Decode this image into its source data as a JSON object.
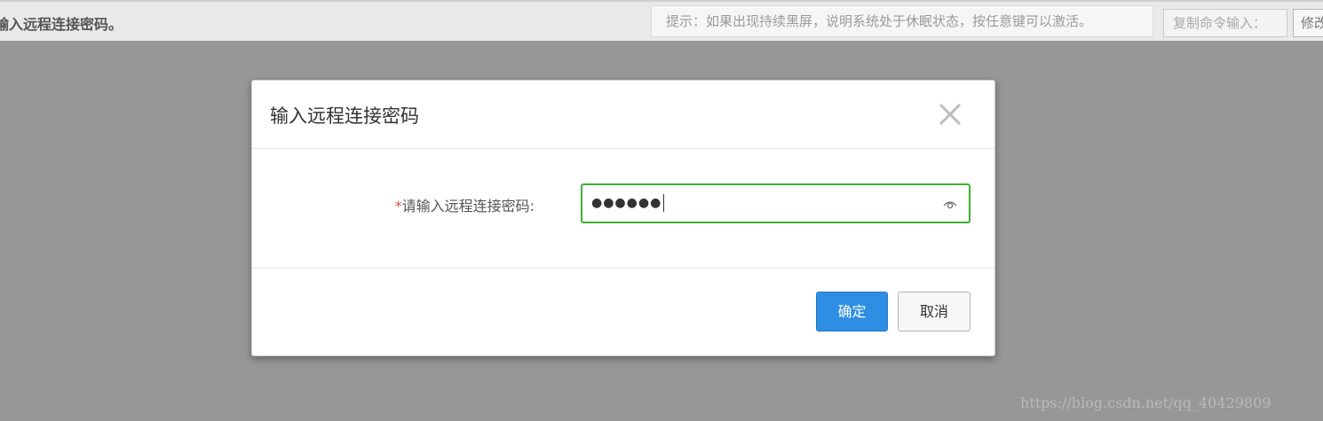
{
  "topbar": {
    "title": "输入远程连接密码。",
    "hint": "提示：如果出现持续黑屏，说明系统处于休眠状态，按任意键可以激活。",
    "copy_input_placeholder": "复制命令输入：",
    "modify_button_label": "修改"
  },
  "dialog": {
    "title": "输入远程连接密码",
    "close_icon": "close-icon",
    "field": {
      "required_mark": "*",
      "label": "请输入远程连接密码:",
      "masked_value": "●●●●●●",
      "reveal_icon": "eye-icon"
    },
    "buttons": {
      "ok_label": "确定",
      "cancel_label": "取消"
    }
  },
  "watermark": "https://blog.csdn.net/qq_40429809",
  "colors": {
    "overlay": "#979797",
    "focus_border": "#3cb034",
    "primary_button": "#2d8ee3",
    "required_mark": "#d9534f"
  }
}
